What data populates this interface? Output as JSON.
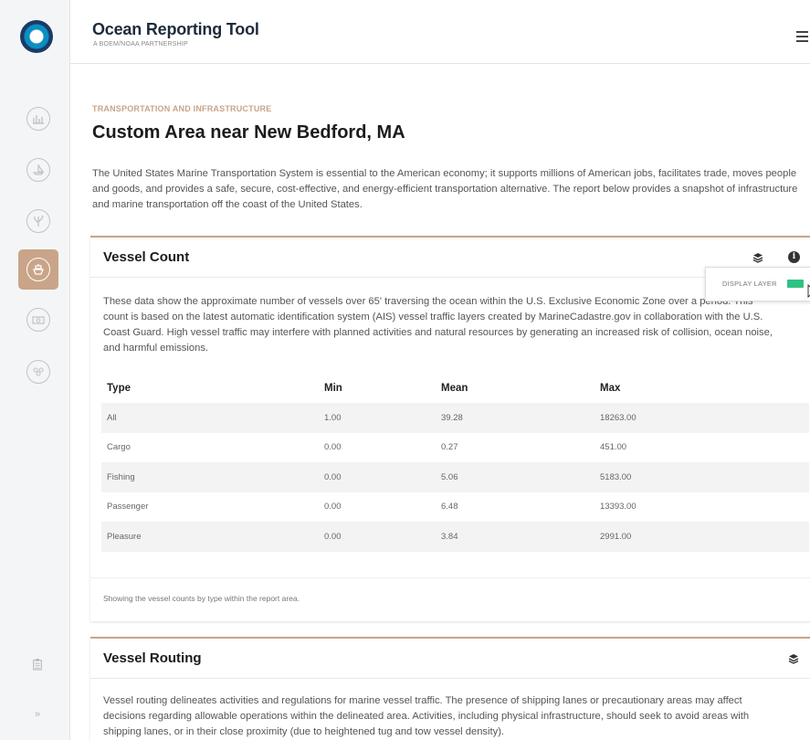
{
  "header": {
    "title": "Ocean Reporting Tool",
    "subtitle": "A BOEM/NOAA PARTNERSHIP"
  },
  "sidebar": {
    "items": [
      {
        "name": "sidebar-item-energy",
        "icon": "bar-chart-icon",
        "active": false
      },
      {
        "name": "sidebar-item-ocean-activities",
        "icon": "sailboat-icon",
        "active": false
      },
      {
        "name": "sidebar-item-natural-resources",
        "icon": "coral-icon",
        "active": false
      },
      {
        "name": "sidebar-item-transportation",
        "icon": "ship-icon",
        "active": true
      },
      {
        "name": "sidebar-item-economics",
        "icon": "money-icon",
        "active": false
      },
      {
        "name": "sidebar-item-general",
        "icon": "people-icon",
        "active": false
      }
    ],
    "expand_label": "»"
  },
  "main": {
    "category": "TRANSPORTATION AND INFRASTRUCTURE",
    "title": "Custom Area near New Bedford, MA",
    "intro": "The United States Marine Transportation System is essential to the American economy; it supports millions of American jobs, facilitates trade, moves people and goods, and provides a safe, secure, cost-effective, and energy-efficient transportation alternative. The report below provides a snapshot of infrastructure and marine transportation off the coast of the United States."
  },
  "vessel_count": {
    "title": "Vessel Count",
    "description": "These data show the approximate number of vessels over 65' traversing the ocean within the U.S. Exclusive Economic Zone over a period. This count is based on the latest automatic identification system (AIS) vessel traffic layers created by MarineCadastre.gov in collaboration with the U.S. Coast Guard. High vessel traffic may interfere with planned activities and natural resources by generating an increased risk of collision, ocean noise, and harmful emissions.",
    "popover": {
      "label": "DISPLAY LAYER",
      "toggle_color": "#2ec283",
      "on": true
    },
    "columns": [
      "Type",
      "Min",
      "Mean",
      "Max"
    ],
    "rows": [
      [
        "All",
        "1.00",
        "39.28",
        "18263.00"
      ],
      [
        "Cargo",
        "0.00",
        "0.27",
        "451.00"
      ],
      [
        "Fishing",
        "0.00",
        "5.06",
        "5183.00"
      ],
      [
        "Passenger",
        "0.00",
        "6.48",
        "13393.00"
      ],
      [
        "Pleasure",
        "0.00",
        "3.84",
        "2991.00"
      ]
    ],
    "caption": "Showing the vessel counts by type within the report area."
  },
  "vessel_routing": {
    "title": "Vessel Routing",
    "description": "Vessel routing delineates activities and regulations for marine vessel traffic. The presence of shipping lanes or precautionary areas may affect decisions regarding allowable operations within the delineated area. Activities, including physical infrastructure, should seek to avoid areas with shipping lanes, or in their close proximity (due to heightened tug and tow vessel density)."
  },
  "colors": {
    "accent": "#c9a488",
    "logo_blue": "#0b8fc2",
    "logo_navy": "#1b3a64"
  }
}
